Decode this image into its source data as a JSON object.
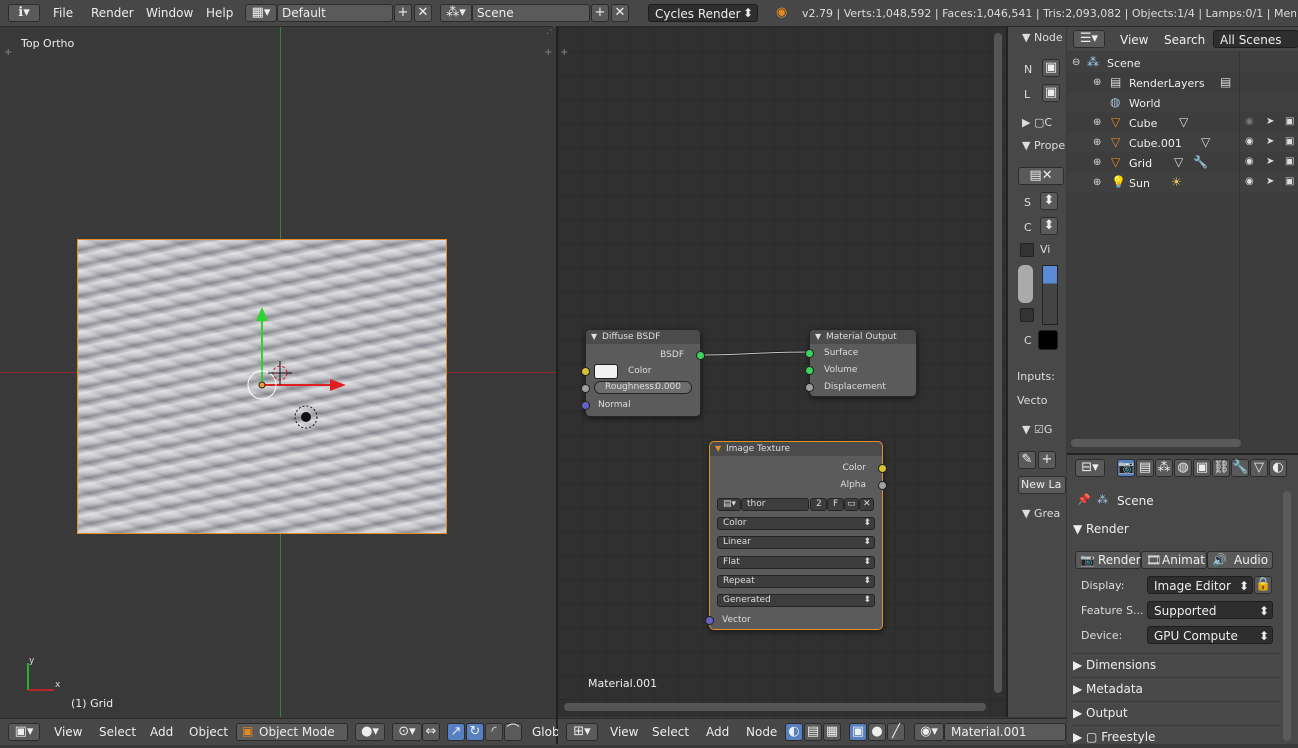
{
  "topbar": {
    "menus": [
      "File",
      "Render",
      "Window",
      "Help"
    ],
    "layout": "Default",
    "scene": "Scene",
    "engine": "Cycles Render",
    "stats": "v2.79 | Verts:1,048,592 | Faces:1,046,541 | Tris:2,093,082 | Objects:1/4 | Lamps:0/1 | Mem:675."
  },
  "viewport": {
    "view_label": "Top Ortho",
    "object_label": "(1) Grid",
    "axis_y": "y",
    "axis_x": "x"
  },
  "view3d_header": {
    "menus": [
      "View",
      "Select",
      "Add",
      "Object"
    ],
    "mode": "Object Mode",
    "transform": "Glob"
  },
  "node_editor": {
    "material_label": "Material.001",
    "diffuse": {
      "title": "Diffuse BSDF",
      "out_bsdf": "BSDF",
      "color_label": "Color",
      "roughness": "Roughness:",
      "roughness_value": "0.000",
      "normal": "Normal"
    },
    "output": {
      "title": "Material Output",
      "surface": "Surface",
      "volume": "Volume",
      "displacement": "Displacement"
    },
    "image": {
      "title": "Image Texture",
      "out_color": "Color",
      "out_alpha": "Alpha",
      "image_name": "thor",
      "users": "2",
      "fake": "F",
      "color_space": "Color",
      "interpolation": "Linear",
      "projection": "Flat",
      "extension": "Repeat",
      "source": "Generated",
      "vector": "Vector"
    }
  },
  "node_header": {
    "menus": [
      "View",
      "Select",
      "Add",
      "Node"
    ],
    "material": "Material.001"
  },
  "side_panel": {
    "node_tab": "Node",
    "n": "N",
    "l": "L",
    "c1": "C",
    "prope": "Prope",
    "s": "S",
    "c2": "C",
    "vi": "Vi",
    "c3": "C",
    "inputs": "Inputs:",
    "vecto": "Vecto",
    "g": "G",
    "new_la": "New La",
    "grea": "Grea"
  },
  "outliner": {
    "view": "View",
    "search": "Search",
    "filter": "All Scenes",
    "items": [
      {
        "label": "Scene"
      },
      {
        "label": "RenderLayers"
      },
      {
        "label": "World"
      },
      {
        "label": "Cube"
      },
      {
        "label": "Cube.001"
      },
      {
        "label": "Grid"
      },
      {
        "label": "Sun"
      }
    ]
  },
  "properties": {
    "scene": "Scene",
    "render_panel": "Render",
    "tab_render": "Render",
    "tab_animation": "Animatio",
    "tab_audio": "Audio",
    "display_label": "Display:",
    "display_value": "Image Editor",
    "feature_label": "Feature S...",
    "feature_value": "Supported",
    "device_label": "Device:",
    "device_value": "GPU Compute",
    "dimensions": "Dimensions",
    "metadata": "Metadata",
    "output": "Output",
    "freestyle": "Freestyle"
  }
}
